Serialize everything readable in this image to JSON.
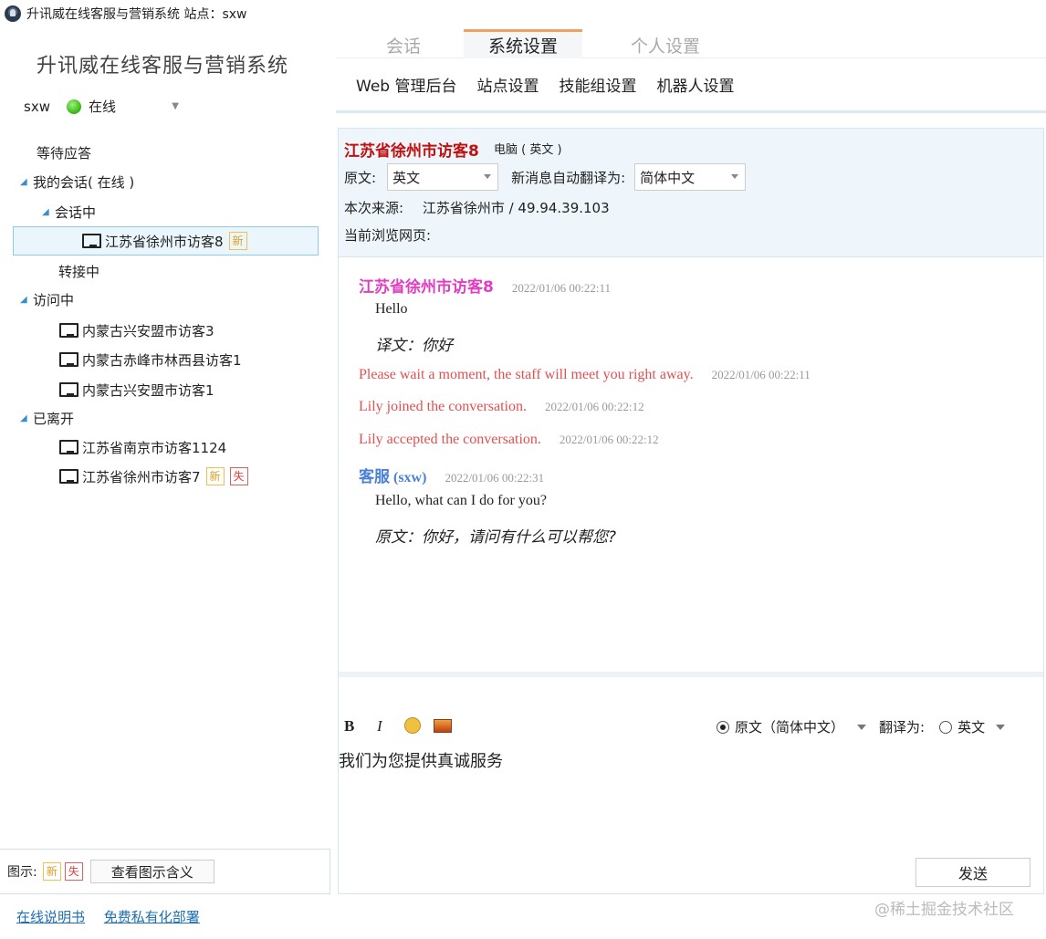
{
  "window": {
    "title": "升讯威在线客服与营销系统  站点：sxw"
  },
  "left": {
    "system_title": "升讯威在线客服与营销系统",
    "user": "sxw",
    "status": "在线",
    "tree": {
      "waiting": "等待应答",
      "my_sessions": "我的会话( 在线 )",
      "in_session": "会话中",
      "selected_visitor": "江苏省徐州市访客8",
      "selected_badge": "新",
      "transferring": "转接中",
      "visiting": "访问中",
      "visiting_items": [
        "内蒙古兴安盟市访客3",
        "内蒙古赤峰市林西县访客1",
        "内蒙古兴安盟市访客1"
      ],
      "left_group": "已离开",
      "left_items": [
        "江苏省南京市访客1124",
        "江苏省徐州市访客7"
      ],
      "left_item2_badges": [
        "新",
        "失"
      ]
    },
    "legend": {
      "label": "图示:",
      "badge_new": "新",
      "badge_lost": "失",
      "button": "查看图示含义"
    },
    "links": [
      "在线说明书",
      "免费私有化部署"
    ]
  },
  "right": {
    "tabs": [
      "会话",
      "系统设置",
      "个人设置"
    ],
    "subtabs": [
      "Web 管理后台",
      "站点设置",
      "技能组设置",
      "机器人设置"
    ],
    "visitor": {
      "name": "江苏省徐州市访客8",
      "device": "电脑 ( 英文 )",
      "original_label": "原文:",
      "original_value": "英文",
      "translate_label": "新消息自动翻译为:",
      "translate_value": "简体中文",
      "source_label": "本次来源:",
      "source_value": "江苏省徐州市  /  49.94.39.103",
      "current_page_label": "当前浏览网页:"
    },
    "messages": {
      "m1_name": "江苏省徐州市访客8",
      "m1_time": "2022/01/06 00:22:11",
      "m1_text": "Hello",
      "m1_trans": "译文：你好",
      "s1_text": "Please wait a moment, the staff will meet you right away.",
      "s1_time": "2022/01/06 00:22:11",
      "s2_text": "Lily joined the conversation.",
      "s2_time": "2022/01/06 00:22:12",
      "s3_text": "Lily accepted the conversation.",
      "s3_time": "2022/01/06 00:22:12",
      "m2_name": "客服",
      "m2_user": "(sxw)",
      "m2_time": "2022/01/06 00:22:31",
      "m2_text": "Hello, what can I do for you?",
      "m2_orig": "原文：你好，请问有什么可以帮您?"
    },
    "input": {
      "bold": "B",
      "italic": "I",
      "original_option": "原文（简体中文）",
      "translate_to_label": "翻译为:",
      "translate_to_option": "英文",
      "draft": "我们为您提供真诚服务",
      "send": "发送"
    }
  },
  "watermark": "@稀土掘金技术社区",
  "colors": {
    "visitor_name": "#c01010",
    "customer_msg_name": "#e040c0",
    "agent_name": "#4a80d8",
    "system_msg": "#e05050",
    "link": "#1f6fb2"
  }
}
